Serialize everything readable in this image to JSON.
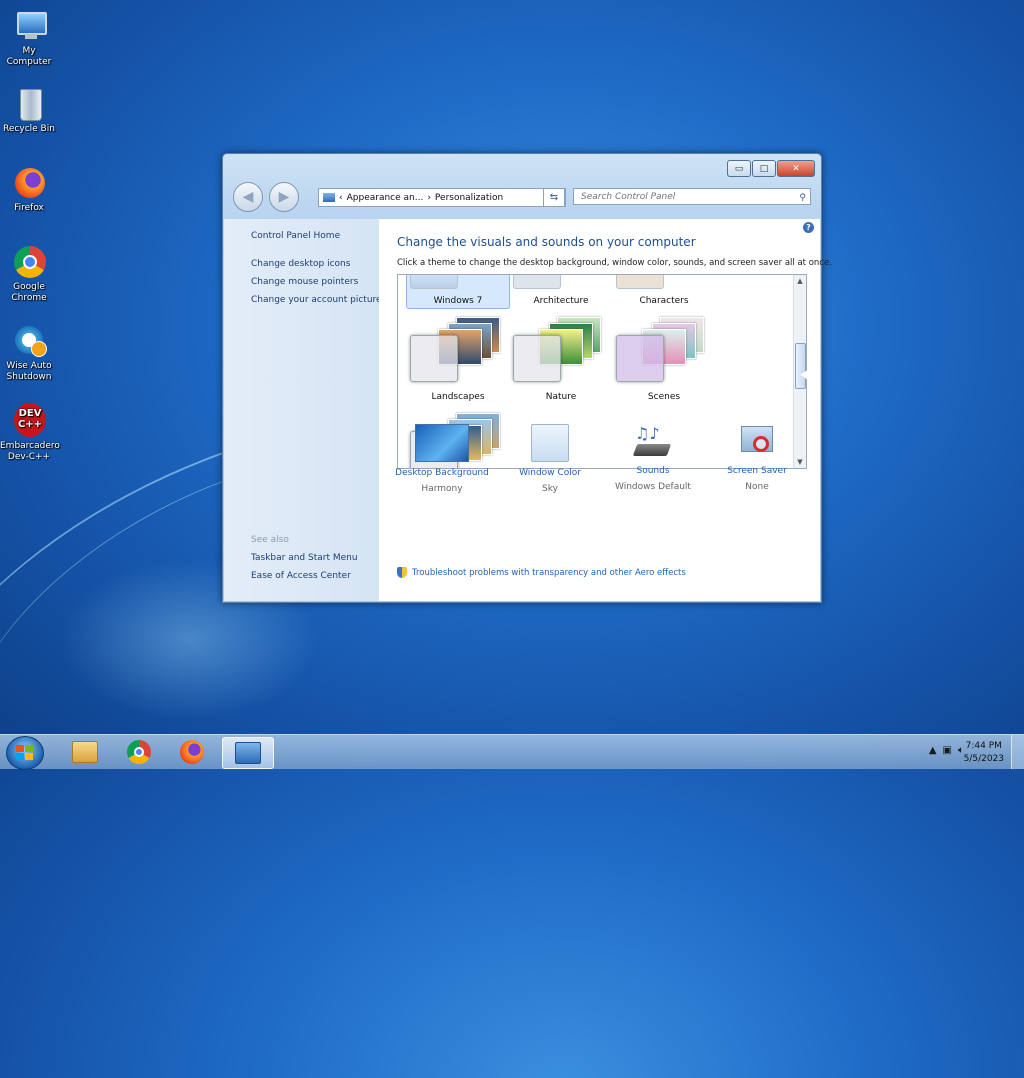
{
  "desktop": {
    "icons": [
      {
        "label": "My Computer",
        "icon": "computer-icon"
      },
      {
        "label": "Recycle Bin",
        "icon": "recycle-bin-icon"
      },
      {
        "label": "Firefox",
        "icon": "firefox-icon"
      },
      {
        "label": "Google Chrome",
        "icon": "chrome-icon"
      },
      {
        "label": "Wise Auto Shutdown",
        "icon": "wise-auto-shutdown-icon"
      },
      {
        "label": "Embarcadero Dev-C++",
        "icon": "devcpp-icon"
      }
    ]
  },
  "window": {
    "address": {
      "seg1": "Appearance an...",
      "seg2": "Personalization"
    },
    "search_placeholder": "Search Control Panel",
    "caption": {
      "min": "▭",
      "max": "□",
      "close": "✕"
    }
  },
  "left_pane": {
    "home": "Control Panel Home",
    "links": [
      "Change desktop icons",
      "Change mouse pointers",
      "Change your account picture"
    ],
    "see_also": "See also",
    "see_also_links": [
      "Taskbar and Start Menu",
      "Ease of Access Center"
    ]
  },
  "main": {
    "title": "Change the visuals and sounds on your computer",
    "subtitle": "Click a theme to change the desktop background, window color, sounds, and screen saver all at once.",
    "themes_row1": [
      "Windows 7",
      "Architecture",
      "Characters"
    ],
    "themes_row2": [
      "Landscapes",
      "Nature",
      "Scenes"
    ],
    "bottom": [
      {
        "label": "Desktop Background",
        "value": "Harmony"
      },
      {
        "label": "Window Color",
        "value": "Sky"
      },
      {
        "label": "Sounds",
        "value": "Windows Default"
      },
      {
        "label": "Screen Saver",
        "value": "None"
      }
    ],
    "troubleshoot": "Troubleshoot problems with transparency and other Aero effects"
  },
  "taskbar": {
    "time": "7:44 PM",
    "date": "5/5/2023"
  }
}
